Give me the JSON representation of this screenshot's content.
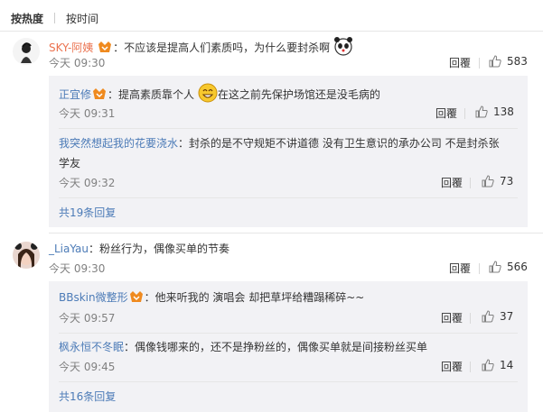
{
  "sort": {
    "hot": "按热度",
    "time": "按时间"
  },
  "labels": {
    "reply": "回覆"
  },
  "comments": [
    {
      "user": "SKY-阿姨",
      "text": "：不应该是提高人们素质吗，为什么要封杀啊",
      "time": "今天 09:30",
      "likes": "583",
      "replies": [
        {
          "user": "正宜修",
          "text": "：提高素质靠个人",
          "text2": "在这之前先保护场馆还是没毛病的",
          "time": "今天 09:31",
          "likes": "138"
        },
        {
          "user": "我突然想起我的花要浇水",
          "text": "：封杀的是不守规矩不讲道德 没有卫生意识的承办公司 不是封杀张",
          "text2": "学友",
          "time": "今天 09:32",
          "likes": "73"
        }
      ],
      "more": "共19条回复"
    },
    {
      "user": "_LiaYau",
      "text": "：粉丝行为，偶像买单的节奏",
      "time": "今天 09:30",
      "likes": "566",
      "replies": [
        {
          "user": "BBskin微整形",
          "text": "：他来听我的 演唱会 却把草坪给糟蹋稀碎~~",
          "time": "今天 09:57",
          "likes": "37"
        },
        {
          "user": "枫永恒不冬眠",
          "text": "：偶像钱哪来的，还不是挣粉丝的，偶像买单就是间接粉丝买单",
          "time": "今天 09:45",
          "likes": "14"
        }
      ],
      "more": "共16条回复"
    }
  ],
  "colors": {
    "username": "#eb7350",
    "link": "#4c7bb7",
    "meta": "#808080",
    "reply_bg": "#f2f2f5"
  }
}
